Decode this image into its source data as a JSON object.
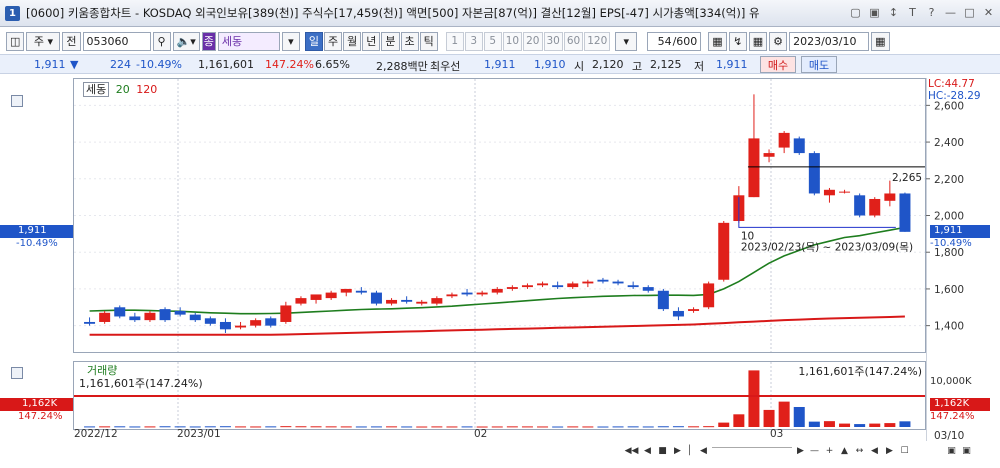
{
  "window": {
    "title": "[0600] 키움종합차트 - KOSDAQ 외국인보유[389(천)] 주식수[17,459(천)] 액면[500] 자본금[87(억)] 결산[12월] EPS[-47] 시가총액[334(억)] 유",
    "app_icon": "1"
  },
  "toolbar": {
    "stock_type": "주",
    "prev_label": "전",
    "stock_code": "053060",
    "stock_name": "세동",
    "stock_name_badge": "종",
    "periods": [
      "일",
      "주",
      "월",
      "년",
      "분",
      "초",
      "틱"
    ],
    "active_period": "일",
    "intervals": [
      "1",
      "3",
      "5",
      "10",
      "20",
      "30",
      "60",
      "120"
    ],
    "count": "54",
    "count_total": "/600",
    "date": "2023/03/10"
  },
  "quote": {
    "price": "1,911",
    "change_arrow": "▼",
    "change": "224",
    "change_rate": "-10.49%",
    "volume": "1,161,601",
    "volume_rate": "147.24%",
    "turnover": "6.65%",
    "amount": "2,288백만",
    "best_bid_label": "최우선",
    "best_ask": "1,911",
    "best_bid": "1,910",
    "open_label": "시",
    "open": "2,120",
    "high_label": "고",
    "high": "2,125",
    "low_label": "저",
    "low": "1,911",
    "buy_label": "매수",
    "sell_label": "매도"
  },
  "price_panel": {
    "legend_name": "세동",
    "ma_short": "20",
    "ma_long": "120",
    "lc_label": "LC:44.77",
    "hc_label": "HC:-28.29",
    "hline_value": "2,265",
    "range_start_label": "10",
    "range_text": "2023/02/23(목) ~ 2023/03/09(목)",
    "last_price": "1,911",
    "last_rate": "-10.49%",
    "yticks": [
      "2,600",
      "2,400",
      "2,200",
      "2,000",
      "1,800",
      "1,600",
      "1,400"
    ]
  },
  "volume_panel": {
    "legend_name": "거래량",
    "summary": "1,161,601주(147.24%)",
    "summary_right": "1,161,601주(147.24%)",
    "ytick": "10,000K",
    "last_volume": "1,162K",
    "last_rate": "147.24%"
  },
  "xaxis": {
    "labels": [
      "2022/12",
      "2023/01",
      "02",
      "03"
    ],
    "right_label": "03/10"
  },
  "colors": {
    "up": "#e0201a",
    "down": "#1f55c8",
    "ma20": "#1e7d1e",
    "ma120": "#d81818"
  },
  "chart_data": {
    "type": "candlestick",
    "title": "세동",
    "ylim": [
      1300,
      2700
    ],
    "candles": [
      {
        "o": 1420,
        "h": 1445,
        "l": 1400,
        "c": 1410
      },
      {
        "o": 1420,
        "h": 1480,
        "l": 1410,
        "c": 1470
      },
      {
        "o": 1500,
        "h": 1510,
        "l": 1440,
        "c": 1450
      },
      {
        "o": 1450,
        "h": 1470,
        "l": 1420,
        "c": 1430
      },
      {
        "o": 1430,
        "h": 1480,
        "l": 1420,
        "c": 1470
      },
      {
        "o": 1490,
        "h": 1500,
        "l": 1420,
        "c": 1430
      },
      {
        "o": 1480,
        "h": 1500,
        "l": 1450,
        "c": 1460
      },
      {
        "o": 1460,
        "h": 1470,
        "l": 1420,
        "c": 1430
      },
      {
        "o": 1440,
        "h": 1450,
        "l": 1400,
        "c": 1410
      },
      {
        "o": 1420,
        "h": 1440,
        "l": 1360,
        "c": 1380
      },
      {
        "o": 1390,
        "h": 1420,
        "l": 1380,
        "c": 1400
      },
      {
        "o": 1400,
        "h": 1440,
        "l": 1390,
        "c": 1430
      },
      {
        "o": 1440,
        "h": 1450,
        "l": 1390,
        "c": 1400
      },
      {
        "o": 1420,
        "h": 1530,
        "l": 1410,
        "c": 1510
      },
      {
        "o": 1520,
        "h": 1560,
        "l": 1510,
        "c": 1550
      },
      {
        "o": 1540,
        "h": 1560,
        "l": 1520,
        "c": 1570
      },
      {
        "o": 1550,
        "h": 1590,
        "l": 1540,
        "c": 1580
      },
      {
        "o": 1580,
        "h": 1600,
        "l": 1560,
        "c": 1600
      },
      {
        "o": 1590,
        "h": 1610,
        "l": 1570,
        "c": 1580
      },
      {
        "o": 1580,
        "h": 1590,
        "l": 1510,
        "c": 1520
      },
      {
        "o": 1520,
        "h": 1550,
        "l": 1510,
        "c": 1540
      },
      {
        "o": 1540,
        "h": 1560,
        "l": 1520,
        "c": 1530
      },
      {
        "o": 1520,
        "h": 1540,
        "l": 1510,
        "c": 1530
      },
      {
        "o": 1520,
        "h": 1560,
        "l": 1510,
        "c": 1550
      },
      {
        "o": 1560,
        "h": 1580,
        "l": 1550,
        "c": 1570
      },
      {
        "o": 1580,
        "h": 1600,
        "l": 1560,
        "c": 1570
      },
      {
        "o": 1570,
        "h": 1590,
        "l": 1560,
        "c": 1580
      },
      {
        "o": 1580,
        "h": 1610,
        "l": 1570,
        "c": 1600
      },
      {
        "o": 1600,
        "h": 1620,
        "l": 1590,
        "c": 1610
      },
      {
        "o": 1610,
        "h": 1630,
        "l": 1600,
        "c": 1620
      },
      {
        "o": 1620,
        "h": 1640,
        "l": 1610,
        "c": 1630
      },
      {
        "o": 1620,
        "h": 1640,
        "l": 1600,
        "c": 1610
      },
      {
        "o": 1610,
        "h": 1640,
        "l": 1600,
        "c": 1630
      },
      {
        "o": 1630,
        "h": 1650,
        "l": 1610,
        "c": 1640
      },
      {
        "o": 1650,
        "h": 1660,
        "l": 1630,
        "c": 1640
      },
      {
        "o": 1640,
        "h": 1650,
        "l": 1620,
        "c": 1630
      },
      {
        "o": 1620,
        "h": 1640,
        "l": 1600,
        "c": 1610
      },
      {
        "o": 1610,
        "h": 1620,
        "l": 1580,
        "c": 1590
      },
      {
        "o": 1590,
        "h": 1600,
        "l": 1480,
        "c": 1490
      },
      {
        "o": 1480,
        "h": 1500,
        "l": 1430,
        "c": 1450
      },
      {
        "o": 1480,
        "h": 1500,
        "l": 1470,
        "c": 1490
      },
      {
        "o": 1500,
        "h": 1640,
        "l": 1490,
        "c": 1630
      },
      {
        "o": 1650,
        "h": 1970,
        "l": 1640,
        "c": 1960
      },
      {
        "o": 1970,
        "h": 2160,
        "l": 1960,
        "c": 2110
      },
      {
        "o": 2100,
        "h": 2660,
        "l": 2100,
        "c": 2420
      },
      {
        "o": 2320,
        "h": 2360,
        "l": 2290,
        "c": 2340
      },
      {
        "o": 2370,
        "h": 2460,
        "l": 2340,
        "c": 2450
      },
      {
        "o": 2420,
        "h": 2430,
        "l": 2330,
        "c": 2340
      },
      {
        "o": 2340,
        "h": 2350,
        "l": 2110,
        "c": 2120
      },
      {
        "o": 2110,
        "h": 2150,
        "l": 2070,
        "c": 2140
      },
      {
        "o": 2130,
        "h": 2140,
        "l": 2120,
        "c": 2130
      },
      {
        "o": 2110,
        "h": 2120,
        "l": 1990,
        "c": 2000
      },
      {
        "o": 2000,
        "h": 2100,
        "l": 1990,
        "c": 2090
      },
      {
        "o": 2080,
        "h": 2190,
        "l": 2050,
        "c": 2120
      },
      {
        "o": 2120,
        "h": 2125,
        "l": 1911,
        "c": 1911
      }
    ],
    "ma20": [
      1480,
      1482,
      1484,
      1484,
      1482,
      1480,
      1478,
      1474,
      1470,
      1468,
      1465,
      1465,
      1466,
      1468,
      1472,
      1476,
      1480,
      1484,
      1488,
      1490,
      1492,
      1495,
      1498,
      1502,
      1506,
      1512,
      1518,
      1524,
      1530,
      1536,
      1542,
      1548,
      1552,
      1556,
      1560,
      1562,
      1564,
      1565,
      1566,
      1566,
      1565,
      1570,
      1600,
      1640,
      1690,
      1740,
      1780,
      1810,
      1840,
      1860,
      1880,
      1890,
      1905,
      1920,
      1935
    ],
    "ma120": [
      1350,
      1350,
      1350,
      1350,
      1350,
      1350,
      1350,
      1350,
      1350,
      1350,
      1350,
      1350,
      1350,
      1352,
      1354,
      1356,
      1358,
      1360,
      1362,
      1364,
      1366,
      1368,
      1370,
      1372,
      1374,
      1376,
      1378,
      1380,
      1382,
      1384,
      1386,
      1388,
      1390,
      1392,
      1394,
      1396,
      1398,
      1400,
      1402,
      1404,
      1406,
      1410,
      1414,
      1418,
      1422,
      1426,
      1430,
      1433,
      1436,
      1439,
      1441,
      1443,
      1445,
      1447,
      1450
    ],
    "volume": [
      120,
      130,
      140,
      110,
      120,
      150,
      130,
      110,
      140,
      160,
      120,
      110,
      130,
      170,
      150,
      140,
      130,
      120,
      110,
      120,
      130,
      110,
      100,
      120,
      110,
      120,
      100,
      110,
      130,
      120,
      110,
      100,
      120,
      110,
      100,
      120,
      130,
      110,
      150,
      160,
      140,
      170,
      900,
      2600,
      11600,
      3500,
      5200,
      4100,
      1100,
      1200,
      700,
      600,
      700,
      800,
      1162
    ],
    "volume_ylim": [
      0,
      12500
    ]
  }
}
